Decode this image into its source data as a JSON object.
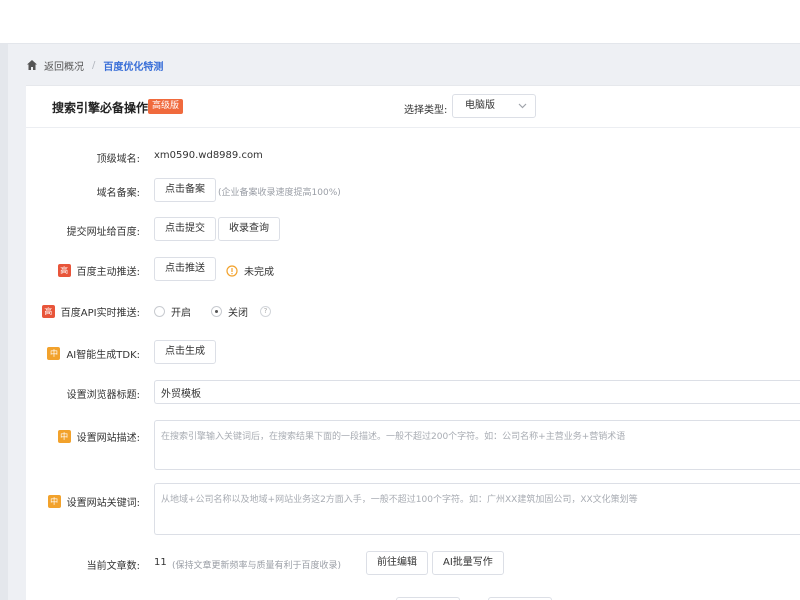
{
  "breadcrumb": {
    "back": "返回概况",
    "separator": "/",
    "current": "百度优化特测"
  },
  "header": {
    "title": "搜索引擎必备操作",
    "badge": "高级版",
    "type_label": "选择类型:",
    "type_selected": "电脑版"
  },
  "rows": {
    "domain": {
      "label": "顶级域名:",
      "value": "xm0590.wd8989.com"
    },
    "icp": {
      "label": "域名备案:",
      "button": "点击备案",
      "hint": "(企业备案收录速度提高100%)"
    },
    "submit": {
      "label": "提交网址给百度:",
      "button1": "点击提交",
      "button2": "收录查询"
    },
    "push": {
      "tag": "高",
      "label": "百度主动推送:",
      "button": "点击推送",
      "status": "未完成",
      "status_color": "#f2a22c"
    },
    "api": {
      "tag": "高",
      "label": "百度API实时推送:",
      "option_on": "开启",
      "option_off": "关闭",
      "selected": "关闭"
    },
    "tdk": {
      "tag": "中",
      "label": "AI智能生成TDK:",
      "button": "点击生成"
    },
    "browser_title": {
      "label": "设置浏览器标题:",
      "value": "外贸模板"
    },
    "description": {
      "tag": "中",
      "label": "设置网站描述:",
      "placeholder": "在搜索引擎输入关键词后，在搜索结果下面的一段描述。一般不超过200个字符。如：公司名称+主营业务+营销术语"
    },
    "keywords": {
      "tag": "中",
      "label": "设置网站关键词:",
      "placeholder": "从地域+公司名称以及地域+网站业务这2方面入手，一般不超过100个字符。如：广州XX建筑加固公司，XX文化策划等"
    },
    "articles": {
      "label": "当前文章数:",
      "count": "11",
      "hint": "(保持文章更新频率与质量有利于百度收录)",
      "button1": "前往编辑",
      "button2": "AI批量写作"
    }
  },
  "colors": {
    "accent": "#3a6fd8",
    "tag_high": "#e8553a",
    "tag_mid": "#f2a22c",
    "badge": "#f06a3d"
  }
}
